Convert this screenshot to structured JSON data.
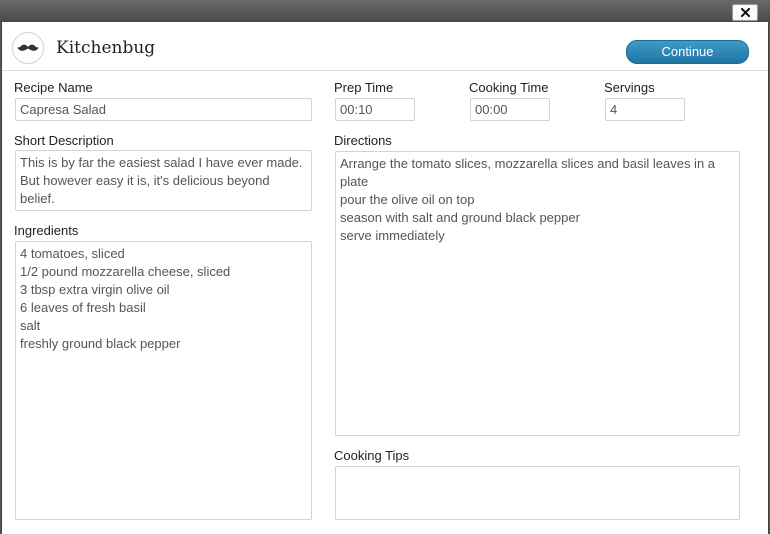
{
  "window": {
    "close_icon": "close-icon"
  },
  "header": {
    "logo_icon": "mustache-icon",
    "brand": "Kitchenbug",
    "continue_label": "Continue",
    "continue_color": "#2a82b3"
  },
  "form": {
    "recipe_name": {
      "label": "Recipe Name",
      "value": "Capresa Salad"
    },
    "prep_time": {
      "label": "Prep Time",
      "value": "00:10"
    },
    "cooking_time": {
      "label": "Cooking Time",
      "value": "00:00"
    },
    "servings": {
      "label": "Servings",
      "value": "4"
    },
    "short_description": {
      "label": "Short Description",
      "value": "This is by far the easiest salad I have ever made. But however easy it is, it's delicious beyond belief."
    },
    "directions": {
      "label": "Directions",
      "value": "Arrange the tomato slices, mozzarella slices and basil leaves in a plate\npour the olive oil on top\nseason with salt and ground black pepper\nserve immediately"
    },
    "ingredients": {
      "label": "Ingredients",
      "value": "4 tomatoes, sliced\n1/2 pound mozzarella cheese, sliced\n3 tbsp extra virgin olive oil\n6 leaves of fresh basil\nsalt\nfreshly ground black pepper"
    },
    "cooking_tips": {
      "label": "Cooking Tips",
      "value": ""
    }
  }
}
